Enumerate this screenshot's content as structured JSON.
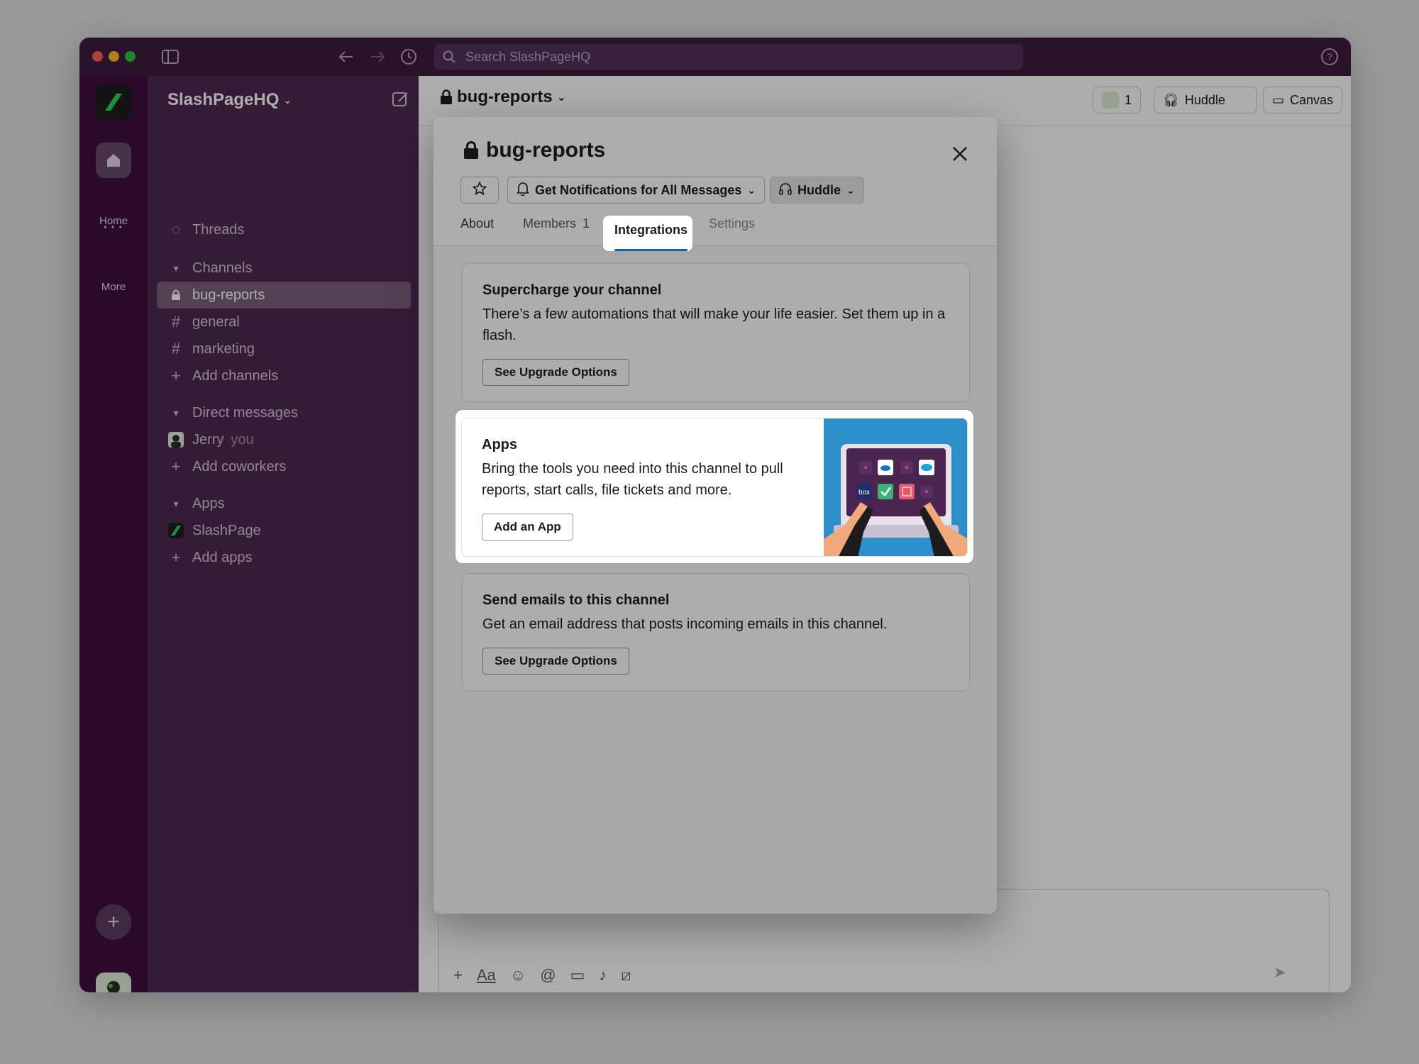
{
  "window": {
    "search_placeholder": "Search SlashPageHQ"
  },
  "rail": {
    "home_label": "Home",
    "more_label": "More"
  },
  "sidebar": {
    "workspace_name": "SlashPageHQ",
    "threads": "Threads",
    "channels_header": "Channels",
    "channels": [
      "bug-reports",
      "general",
      "marketing"
    ],
    "add_channels": "Add channels",
    "dm_header": "Direct messages",
    "dm_user": "Jerry",
    "dm_you": "you",
    "add_coworkers": "Add coworkers",
    "apps_header": "Apps",
    "app_name": "SlashPage",
    "add_apps": "Add apps"
  },
  "main": {
    "channel_name": "bug-reports",
    "member_count": "1",
    "huddle_label": "Huddle",
    "canvas_label": "Canvas"
  },
  "modal": {
    "title": "bug-reports",
    "notifications_label": "Get Notifications for All Messages",
    "huddle_label": "Huddle",
    "tabs": {
      "about": "About",
      "members": "Members",
      "members_count": "1",
      "integrations": "Integrations",
      "settings": "Settings"
    },
    "supercharge": {
      "title": "Supercharge your channel",
      "body_line1": "There’s a few automations that will make your life easier. Set them up in a",
      "body_line2": "flash.",
      "button": "See Upgrade Options"
    },
    "apps": {
      "title": "Apps",
      "body_line1": "Bring the tools you need into this channel to pull",
      "body_line2": "reports, start calls, file tickets and more.",
      "button": "Add an App",
      "illustration_box_label": "box"
    },
    "emails": {
      "title": "Send emails to this channel",
      "body": "Get an email address that posts incoming emails in this channel.",
      "button": "See Upgrade Options"
    }
  },
  "colors": {
    "aubergine": "#3f0e40",
    "sidebar": "#4d2a51",
    "active_tab_underline": "#1264a3",
    "illustration_bg": "#2c8fc9"
  }
}
